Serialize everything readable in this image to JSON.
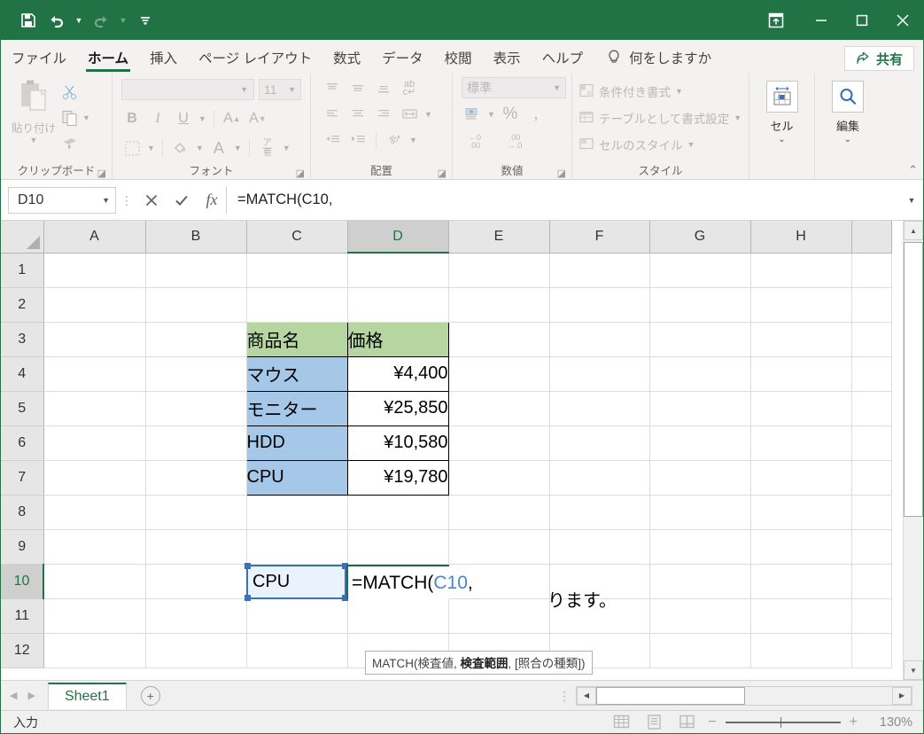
{
  "titlebar": {
    "qat": [
      {
        "name": "save-icon",
        "label": "上書き保存"
      },
      {
        "name": "undo-icon",
        "label": "元に戻す"
      },
      {
        "name": "redo-icon",
        "label": "やり直し"
      },
      {
        "name": "customize-qat-icon",
        "label": "クイック アクセス ツール バーのユーザー設定"
      }
    ],
    "window_buttons": [
      {
        "name": "ribbon-display-options-icon",
        "label": "リボンの表示オプション"
      },
      {
        "name": "minimize-icon",
        "label": "最小化"
      },
      {
        "name": "maximize-icon",
        "label": "最大化"
      },
      {
        "name": "close-icon",
        "label": "閉じる"
      }
    ],
    "accent": "#217346"
  },
  "tabs": [
    {
      "label": "ファイル",
      "active": false
    },
    {
      "label": "ホーム",
      "active": true
    },
    {
      "label": "挿入",
      "active": false
    },
    {
      "label": "ページ レイアウト",
      "active": false
    },
    {
      "label": "数式",
      "active": false
    },
    {
      "label": "データ",
      "active": false
    },
    {
      "label": "校閲",
      "active": false
    },
    {
      "label": "表示",
      "active": false
    },
    {
      "label": "ヘルプ",
      "active": false
    }
  ],
  "tellme": {
    "icon": "lightbulb-icon",
    "placeholder": "何をしますか"
  },
  "share": {
    "label": "共有",
    "icon": "share-icon"
  },
  "ribbon": {
    "groups": [
      {
        "name": "clipboard",
        "label": "クリップボード",
        "paste_label": "貼り付け",
        "items": [
          "切り取り",
          "コピー",
          "書式のコピー/貼り付け"
        ]
      },
      {
        "name": "font",
        "label": "フォント",
        "font_name": "",
        "font_size": "11",
        "items": [
          "B",
          "I",
          "U",
          "A",
          "A"
        ]
      },
      {
        "name": "alignment",
        "label": "配置",
        "items": [
          "上揃え",
          "中央揃え",
          "下揃え",
          "折り返して全体を表示する",
          "左揃え",
          "中央揃え",
          "右揃え",
          "セルを結合して中央揃え",
          "インデントを減らす",
          "インデントを増やす",
          "方向"
        ]
      },
      {
        "name": "number",
        "label": "数値",
        "format": "標準",
        "items": [
          "通貨表示形式",
          "パーセント スタイル",
          "桁区切りスタイル",
          "小数点以下の表示桁数を増やす",
          "小数点以下の表示桁数を減らす"
        ]
      },
      {
        "name": "styles",
        "label": "スタイル",
        "items": [
          "条件付き書式",
          "テーブルとして書式設定",
          "セルのスタイル"
        ]
      },
      {
        "name": "cells",
        "label": "セル",
        "button": "セル"
      },
      {
        "name": "editing",
        "label": "編集",
        "button": "編集"
      }
    ],
    "collapse_label": "リボンを折りたたむ"
  },
  "formula_bar": {
    "name_box": "D10",
    "cancel_icon": "cancel-icon",
    "enter_icon": "confirm-icon",
    "function_icon": "insert-function-icon",
    "formula_prefix": "=MATCH(",
    "formula_ref": "C10",
    "formula_suffix": ",",
    "expand_icon": "chevron-down-icon"
  },
  "grid": {
    "columns": [
      "A",
      "B",
      "C",
      "D",
      "E",
      "F",
      "G",
      "H"
    ],
    "selected_column": "D",
    "selected_row": "10",
    "rows": [
      "1",
      "2",
      "3",
      "4",
      "5",
      "6",
      "7",
      "8",
      "9",
      "10",
      "11",
      "12"
    ],
    "cells": {
      "C3": "商品名",
      "D3": "価格",
      "C4": "マウス",
      "D4": "¥4,400",
      "C5": "モニター",
      "D5": "¥25,850",
      "C6": "HDD",
      "D6": "¥10,580",
      "C7": "CPU",
      "D7": "¥19,780",
      "C10": "CPU"
    },
    "header_fill": "#b5d6a0",
    "name_fill": "#a5c7e8",
    "edit_cell": {
      "address": "D10",
      "prefix": "=MATCH(",
      "ref": "C10",
      "suffix": ","
    },
    "overflow_text": "ります。",
    "tooltip": {
      "prefix": "MATCH(検査値, ",
      "bold": "検査範囲",
      "suffix": ", [照合の種類])"
    }
  },
  "sheetbar": {
    "prev_icon": "chevron-left-icon",
    "next_icon": "chevron-right-icon",
    "tabs": [
      {
        "label": "Sheet1",
        "active": true
      }
    ],
    "add_label": "+",
    "add_title": "ワークシートの挿入"
  },
  "statusbar": {
    "mode": "入力",
    "view_buttons": [
      {
        "name": "normal-view-icon",
        "label": "標準"
      },
      {
        "name": "page-layout-view-icon",
        "label": "ページ レイアウト"
      },
      {
        "name": "page-break-view-icon",
        "label": "改ページ プレビュー"
      }
    ],
    "zoom_out": "−",
    "zoom_in": "+",
    "zoom_level": "130%"
  }
}
